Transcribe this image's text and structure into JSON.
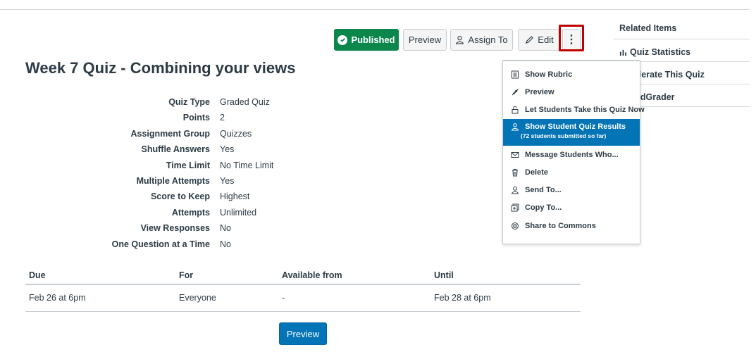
{
  "toolbar": {
    "published_label": "Published",
    "preview_label": "Preview",
    "assign_label": "Assign To",
    "edit_label": "Edit",
    "more_label": "⋮"
  },
  "title": "Week 7 Quiz - Combining your views",
  "details": [
    {
      "label": "Quiz Type",
      "value": "Graded Quiz"
    },
    {
      "label": "Points",
      "value": "2"
    },
    {
      "label": "Assignment Group",
      "value": "Quizzes"
    },
    {
      "label": "Shuffle Answers",
      "value": "Yes"
    },
    {
      "label": "Time Limit",
      "value": "No Time Limit"
    },
    {
      "label": "Multiple Attempts",
      "value": "Yes"
    },
    {
      "label": "Score to Keep",
      "value": "Highest"
    },
    {
      "label": "Attempts",
      "value": "Unlimited"
    },
    {
      "label": "View Responses",
      "value": "No"
    },
    {
      "label": "One Question at a Time",
      "value": "No"
    }
  ],
  "due_table": {
    "headers": [
      "Due",
      "For",
      "Available from",
      "Until"
    ],
    "rows": [
      [
        "Feb 26 at 6pm",
        "Everyone",
        "-",
        "Feb 28 at 6pm"
      ]
    ]
  },
  "bottom_preview_label": "Preview",
  "related": {
    "title": "Related Items",
    "items": [
      "Quiz Statistics",
      "oderate This Quiz",
      "eedGrader"
    ]
  },
  "menu": {
    "items": [
      {
        "label": "Show Rubric",
        "icon": "rubric-icon"
      },
      {
        "label": "Preview",
        "icon": "rocket-icon"
      },
      {
        "label": "Let Students Take this Quiz Now",
        "icon": "unlock-icon"
      },
      {
        "label": "Show Student Quiz Results",
        "sub": "(72 students submitted so far)",
        "icon": "users-icon"
      },
      {
        "label": "Message Students Who...",
        "icon": "envelope-icon"
      },
      {
        "label": "Delete",
        "icon": "trash-icon"
      },
      {
        "label": "Send To...",
        "icon": "user-icon"
      },
      {
        "label": "Copy To...",
        "icon": "copy-icon"
      },
      {
        "label": "Share to Commons",
        "icon": "commons-icon"
      }
    ]
  },
  "colors": {
    "published": "#0b874b",
    "primary": "#0374b5",
    "highlight_box": "#c00000"
  }
}
